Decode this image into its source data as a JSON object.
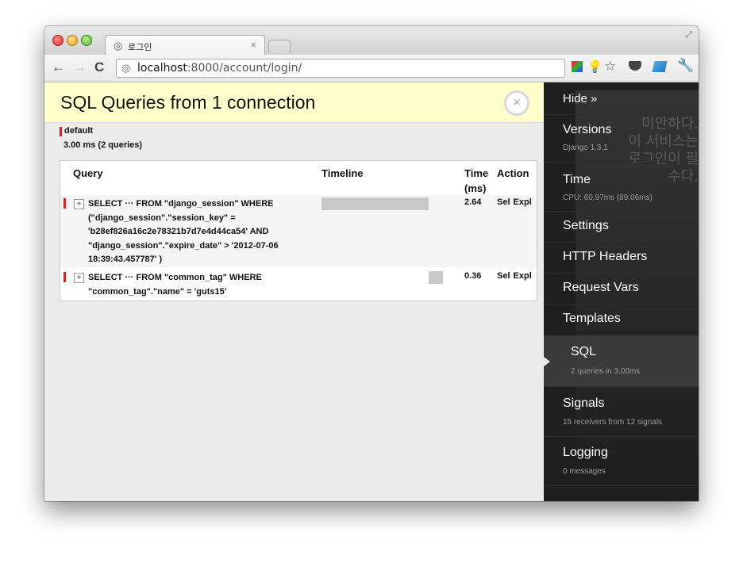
{
  "browser": {
    "tab_title": "로그인",
    "tab_close": "×",
    "url_host": "localhost",
    "url_path": ":8000/account/login/"
  },
  "panel": {
    "title": "SQL Queries from 1 connection",
    "close_label": "×",
    "connection_name": "default",
    "connection_time": "3.00 ms (2 queries)"
  },
  "table": {
    "headers": {
      "query": "Query",
      "timeline": "Timeline",
      "time": "Time (ms)",
      "action": "Action"
    },
    "rows": [
      {
        "sql": "SELECT ··· FROM \"django_session\" WHERE (\"django_session\".\"session_key\" = 'b28ef826a16c2e78321b7d7e4d44ca54' AND \"django_session\".\"expire_date\" > '2012-07-06 18:39:43.457787' )",
        "timeline_start": 0.0,
        "timeline_width": 0.88,
        "time": "2.64",
        "action_sel": "Sel",
        "action_expl": "Expl"
      },
      {
        "sql": "SELECT ··· FROM \"common_tag\" WHERE \"common_tag\".\"name\" = 'guts15'",
        "timeline_start": 0.88,
        "timeline_width": 0.12,
        "time": "0.36",
        "action_sel": "Sel",
        "action_expl": "Expl"
      }
    ]
  },
  "sidebar": {
    "hide": "Hide »",
    "items": [
      {
        "label": "Versions",
        "sub": "Django 1.3.1"
      },
      {
        "label": "Time",
        "sub": "CPU: 60.97ms (89.06ms)"
      },
      {
        "label": "Settings",
        "sub": ""
      },
      {
        "label": "HTTP Headers",
        "sub": ""
      },
      {
        "label": "Request Vars",
        "sub": ""
      },
      {
        "label": "Templates",
        "sub": ""
      },
      {
        "label": "SQL",
        "sub": "2 queries in 3.00ms"
      },
      {
        "label": "Signals",
        "sub": "15 receivers from 12 signals"
      },
      {
        "label": "Logging",
        "sub": "0 messages"
      }
    ],
    "watermark_text": "미안하다. 이 서비스는 로그인이 필수다."
  },
  "colors": {
    "header_bg": "#ffffcc",
    "sidebar_bg": "#1f1f1f",
    "accent_red": "#e02020"
  }
}
